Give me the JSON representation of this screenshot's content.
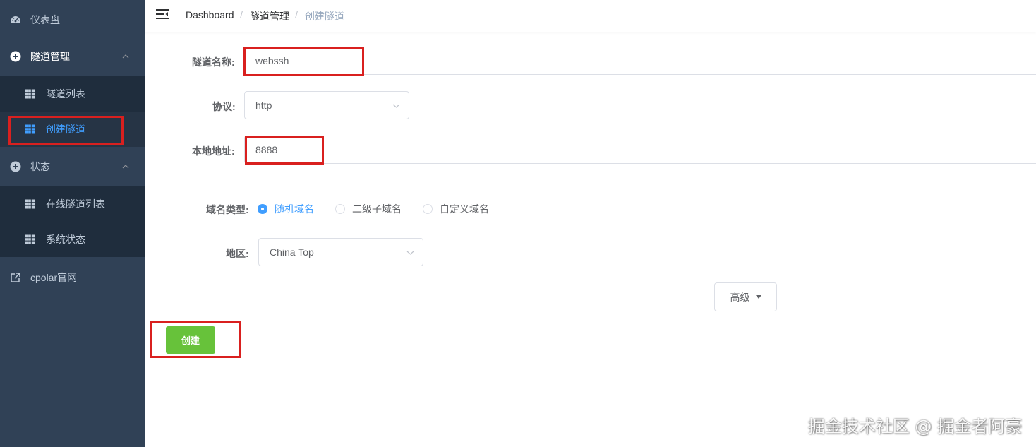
{
  "sidebar": {
    "dashboard": "仪表盘",
    "tunnel_mgmt": "隧道管理",
    "tunnel_list": "隧道列表",
    "create_tunnel": "创建隧道",
    "status": "状态",
    "online_tunnels": "在线隧道列表",
    "system_status": "系统状态",
    "cpolar_site": "cpolar官网"
  },
  "breadcrumb": {
    "home": "Dashboard",
    "sep": "/",
    "section": "隧道管理",
    "current": "创建隧道"
  },
  "form": {
    "name_label": "隧道名称:",
    "name_value": "webssh",
    "protocol_label": "协议:",
    "protocol_value": "http",
    "local_label": "本地地址:",
    "local_value": "8888",
    "domain_type_label": "域名类型:",
    "domain_options": [
      "随机域名",
      "二级子域名",
      "自定义域名"
    ],
    "domain_selected": "随机域名",
    "region_label": "地区:",
    "region_value": "China Top",
    "advanced_label": "高级",
    "create_label": "创建"
  },
  "colors": {
    "sidebar_bg": "#304156",
    "submenu_bg": "#1f2d3d",
    "active_text": "#409eff",
    "create_button": "#67c23a",
    "highlight_box": "#d9201f"
  },
  "watermark": "掘金技术社区 @ 掘金者阿豪"
}
